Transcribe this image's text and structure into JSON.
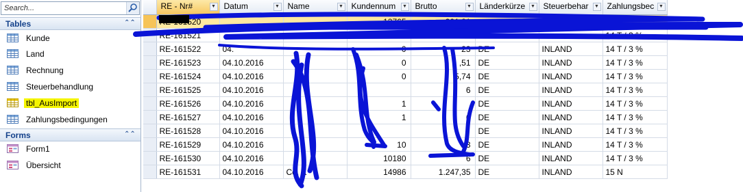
{
  "search": {
    "placeholder": "Search..."
  },
  "nav": {
    "tables_header": "Tables",
    "forms_header": "Forms",
    "tables": [
      "Kunde",
      "Land",
      "Rechnung",
      "Steuerbehandlung",
      "tbl_AusImport",
      "Zahlungsbedingungen"
    ],
    "forms": [
      "Form1",
      "Übersicht"
    ],
    "highlight_color": "#f5f500"
  },
  "grid": {
    "columns": [
      "RE - Nr#",
      "Datum",
      "Name",
      "Kundennum",
      "Brutto",
      "Länderkürze",
      "Steuerbehar",
      "Zahlungsbec"
    ],
    "rows": [
      [
        "RE-161520",
        "",
        "",
        "12765",
        "391,21",
        "",
        "",
        ""
      ],
      [
        "RE-161521",
        "",
        "",
        "",
        "51",
        "DE",
        "",
        "14 T / 3 %"
      ],
      [
        "RE-161522",
        "04.",
        "",
        "0",
        "23",
        "DE",
        "INLAND",
        "14 T / 3 %"
      ],
      [
        "RE-161523",
        "04.10.2016",
        "",
        "0",
        ",51",
        "DE",
        "INLAND",
        "14 T / 3 %"
      ],
      [
        "RE-161524",
        "04.10.2016",
        "",
        "0",
        "5,74",
        "DE",
        "INLAND",
        "14 T / 3 %"
      ],
      [
        "RE-161525",
        "04.10.2016",
        "",
        "",
        "6",
        "DE",
        "INLAND",
        "14 T / 3 %"
      ],
      [
        "RE-161526",
        "04.10.2016",
        "",
        "1",
        "",
        "DE",
        "INLAND",
        "14 T / 3 %"
      ],
      [
        "RE-161527",
        "04.10.2016",
        "",
        "1",
        "6",
        "DE",
        "INLAND",
        "14 T / 3 %"
      ],
      [
        "RE-161528",
        "04.10.2016",
        "",
        "",
        "",
        "DE",
        "INLAND",
        "14 T / 3 %"
      ],
      [
        "RE-161529",
        "04.10.2016",
        "",
        "10",
        "3",
        "DE",
        "INLAND",
        "14 T / 3 %"
      ],
      [
        "RE-161530",
        "04.10.2016",
        "",
        "10180",
        "6",
        "DE",
        "INLAND",
        "14 T / 3 %"
      ],
      [
        "RE-161531",
        "04.10.2016",
        "Co. K",
        "14986",
        "1.247,35",
        "DE",
        "INLAND",
        "15 N"
      ]
    ]
  },
  "colors": {
    "scribble": "#0a14d6",
    "selected_header": "#f7c75f",
    "current_row": "#ffe9a0"
  }
}
